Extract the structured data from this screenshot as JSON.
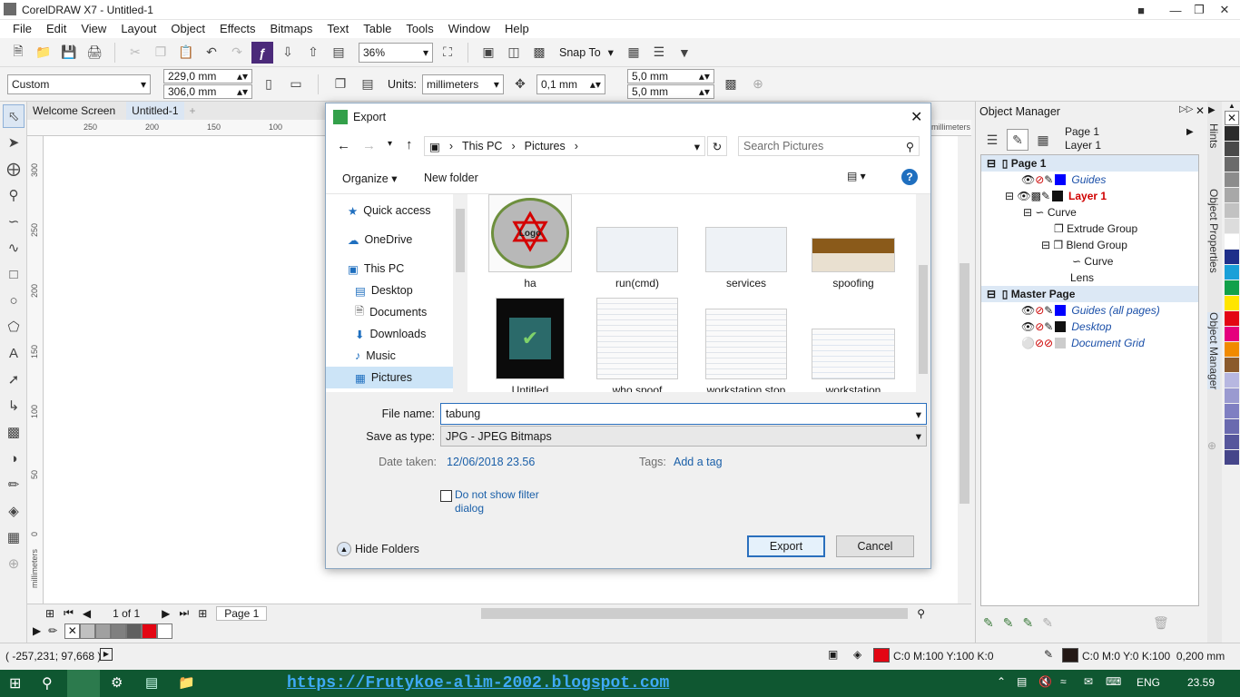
{
  "window": {
    "title": "CorelDRAW X7 - Untitled-1"
  },
  "menu": [
    "File",
    "Edit",
    "View",
    "Layout",
    "Object",
    "Effects",
    "Bitmaps",
    "Text",
    "Table",
    "Tools",
    "Window",
    "Help"
  ],
  "toolbar": {
    "zoom": "36%",
    "snap_to": "Snap To"
  },
  "propbar": {
    "page_size": "Custom",
    "width": "229,0 mm",
    "height": "306,0 mm",
    "units_label": "Units:",
    "units": "millimeters",
    "nudge": "0,1 mm",
    "dup_x": "5,0 mm",
    "dup_y": "5,0 mm"
  },
  "doc_tabs": [
    "Welcome Screen",
    "Untitled-1"
  ],
  "hruler": {
    "ticks": [
      "250",
      "200",
      "150",
      "100"
    ],
    "unit": "millimeters"
  },
  "vruler": {
    "ticks": [
      "300",
      "250",
      "200",
      "150",
      "100",
      "50",
      "0"
    ],
    "unit": "millimeters"
  },
  "page_nav": {
    "counter": "1 of 1",
    "tab": "Page 1"
  },
  "object_manager": {
    "title": "Object Manager",
    "header_page": "Page 1",
    "header_layer": "Layer 1",
    "rows": [
      {
        "label": "Page 1",
        "kind": "page"
      },
      {
        "label": "Guides",
        "kind": "layer"
      },
      {
        "label": "Layer 1",
        "kind": "active"
      },
      {
        "label": "Curve",
        "kind": "obj"
      },
      {
        "label": "Extrude Group",
        "kind": "obj"
      },
      {
        "label": "Blend Group",
        "kind": "obj"
      },
      {
        "label": "Curve",
        "kind": "obj"
      },
      {
        "label": "Lens",
        "kind": "obj"
      },
      {
        "label": "Master Page",
        "kind": "page"
      },
      {
        "label": "Guides (all pages)",
        "kind": "layer"
      },
      {
        "label": "Desktop",
        "kind": "layer"
      },
      {
        "label": "Document Grid",
        "kind": "layer"
      }
    ]
  },
  "dockers": {
    "hints": "Hints",
    "properties": "Object Properties",
    "manager": "Object Manager"
  },
  "palette_colors": [
    "#2b2b2b",
    "#4a4a4a",
    "#6b6b6b",
    "#8c8c8c",
    "#a8a8a8",
    "#c2c2c2",
    "#dcdcdc",
    "#ffffff",
    "#1f2f8a",
    "#1aa0d8",
    "#12a04a",
    "#ffe500",
    "#e30613",
    "#e5007d",
    "#f18a00",
    "#8b5a2b",
    "#b7b7e0",
    "#9a9ad0",
    "#7f7fc2",
    "#6a6aaf",
    "#56569c",
    "#46468a"
  ],
  "bottom_palette": [
    "#c0c0c0",
    "#a0a0a0",
    "#808080",
    "#606060",
    "#e30613",
    "#ffffff"
  ],
  "status": {
    "coords": "( -257,231; 97,668 )",
    "fill": "C:0 M:100 Y:100 K:0",
    "fill_color": "#e30613",
    "outline": "C:0 M:0 Y:0 K:100  0,200 mm",
    "outline_color": "#231815"
  },
  "taskbar": {
    "url": "https://Frutykoe-alim-2002.blogspot.com",
    "lang": "ENG",
    "time": "23.59"
  },
  "dialog": {
    "title": "Export",
    "breadcrumb": [
      "This PC",
      "Pictures"
    ],
    "search_placeholder": "Search Pictures",
    "organize": "Organize",
    "new_folder": "New folder",
    "nav": [
      "Quick access",
      "OneDrive",
      "This PC",
      "Desktop",
      "Documents",
      "Downloads",
      "Music",
      "Pictures"
    ],
    "files": [
      "ha",
      "run(cmd)",
      "services",
      "spoofing",
      "Untitled",
      "who spoof",
      "workstation stop",
      "workstation"
    ],
    "file_name_label": "File name:",
    "file_name": "tabung",
    "save_type_label": "Save as type:",
    "save_type": "JPG - JPEG Bitmaps",
    "date_label": "Date taken:",
    "date": "12/06/2018 23.56",
    "tags_label": "Tags:",
    "tags": "Add a tag",
    "filter_line1": "Do not show filter",
    "filter_line2": "dialog",
    "hide_folders": "Hide Folders",
    "export": "Export",
    "cancel": "Cancel",
    "logo_text": "Logo"
  }
}
